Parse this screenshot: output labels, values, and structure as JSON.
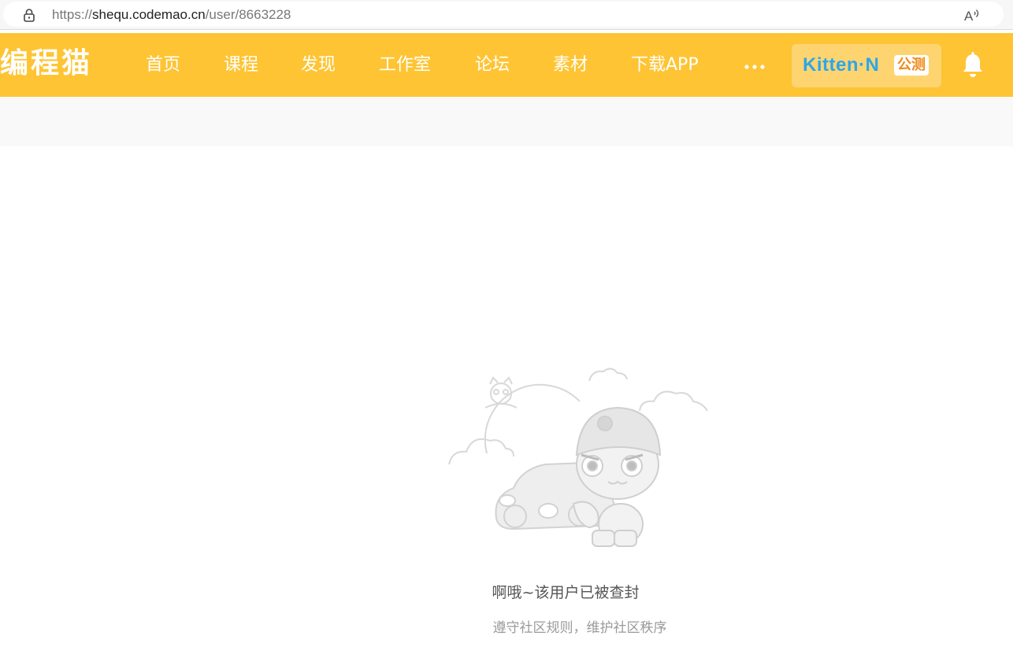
{
  "browser": {
    "url_prefix": "https://",
    "url_host": "shequ.codemao.cn",
    "url_path": "/user/8663228"
  },
  "navbar": {
    "logo": "编程猫",
    "items": [
      {
        "label": "首页"
      },
      {
        "label": "课程"
      },
      {
        "label": "发现"
      },
      {
        "label": "工作室"
      },
      {
        "label": "论坛"
      },
      {
        "label": "素材"
      },
      {
        "label": "下载APP"
      }
    ],
    "kitten": {
      "name": "Kitten·N",
      "tag": "公测"
    }
  },
  "empty_state": {
    "title": "啊哦~该用户已被查封",
    "subtitle": "遵守社区规则，维护社区秩序"
  },
  "colors": {
    "brand": "#fec433",
    "kitten_blue": "#2aa7ea",
    "tag_orange": "#f08a1c"
  },
  "icons": {
    "lock": "lock-icon",
    "read_aloud": "read-aloud-icon",
    "more": "more-dots-icon",
    "bell": "bell-icon"
  }
}
